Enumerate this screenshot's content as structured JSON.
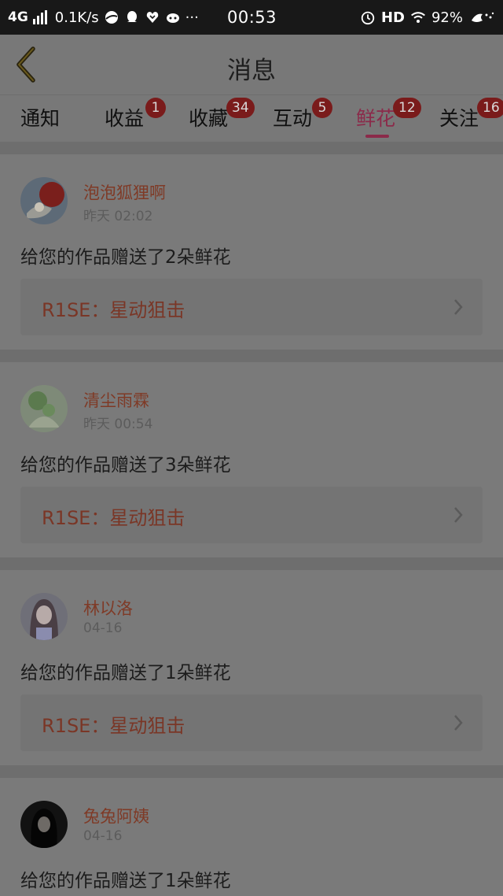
{
  "status_bar": {
    "network": "4G",
    "speed": "0.1K/s",
    "more": "···",
    "time": "00:53",
    "hd": "HD",
    "battery": "92%",
    "icons": [
      "signal-icon",
      "app-icon",
      "qq-icon",
      "heart-app-icon",
      "cat-app-icon",
      "alarm-icon",
      "wifi-icon",
      "battery-icon"
    ]
  },
  "header": {
    "title": "消息",
    "back_icon": "chevron-left-icon"
  },
  "tabs": [
    {
      "label": "通知",
      "badge": ""
    },
    {
      "label": "收益",
      "badge": "1"
    },
    {
      "label": "收藏",
      "badge": "34"
    },
    {
      "label": "互动",
      "badge": "5"
    },
    {
      "label": "鲜花",
      "badge": "12",
      "active": true
    },
    {
      "label": "关注",
      "badge": "16"
    }
  ],
  "notifications": [
    {
      "user": "泡泡狐狸啊",
      "time": "昨天 02:02",
      "message": "给您的作品赠送了2朵鲜花",
      "work": "R1SE：星动狙击"
    },
    {
      "user": "清尘雨霖",
      "time": "昨天 00:54",
      "message": "给您的作品赠送了3朵鲜花",
      "work": "R1SE：星动狙击"
    },
    {
      "user": "林以洛",
      "time": "04-16",
      "message": "给您的作品赠送了1朵鲜花",
      "work": "R1SE：星动狙击"
    },
    {
      "user": "兔兔阿姨",
      "time": "04-16",
      "message": "给您的作品赠送了1朵鲜花",
      "work": ""
    }
  ],
  "colors": {
    "accent": "#8b2a4a",
    "badge": "#7a1b1b",
    "username": "#7f3a26",
    "overlay_bg": "#787878"
  }
}
